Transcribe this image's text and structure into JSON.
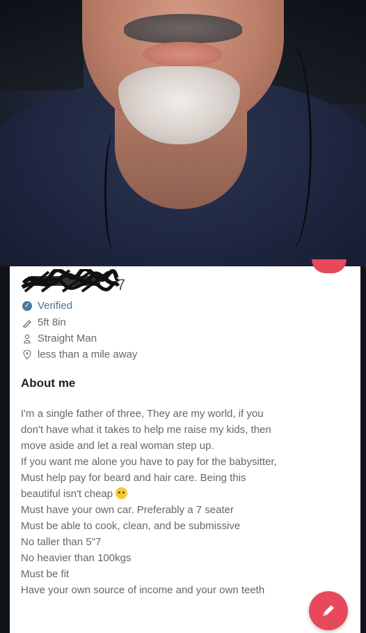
{
  "profile": {
    "name_age_visible": "7",
    "verified_label": "Verified",
    "height": "5ft 8in",
    "orientation": "Straight Man",
    "distance": "less than a mile away"
  },
  "about": {
    "title": "About me",
    "lines": [
      "I'm a single father of three, They are my world, if you",
      "don't have what it takes to help me raise my kids, then",
      "move aside and let a real woman step up.",
      "If you want me alone you have to pay for the babysitter,",
      "Must help pay for beard and hair care. Being this",
      "beautiful isn't cheap",
      "Must have your own car. Preferably a 7 seater",
      "Must be able to cook, clean, and be submissive",
      "No taller than 5\"7",
      "No heavier than 100kgs",
      "Must be fit",
      "Have your own source of income and your own teeth"
    ]
  },
  "icons": {
    "verified": "check-badge-icon",
    "height": "ruler-pencil-icon",
    "orientation": "person-icon",
    "distance": "location-pin-icon",
    "emoji": "grinning-sweat-emoji",
    "fab": "pencil-edit-icon"
  },
  "colors": {
    "accent": "#e8485c",
    "verified": "#4a7aa0",
    "text": "#666666",
    "heading": "#222222"
  }
}
